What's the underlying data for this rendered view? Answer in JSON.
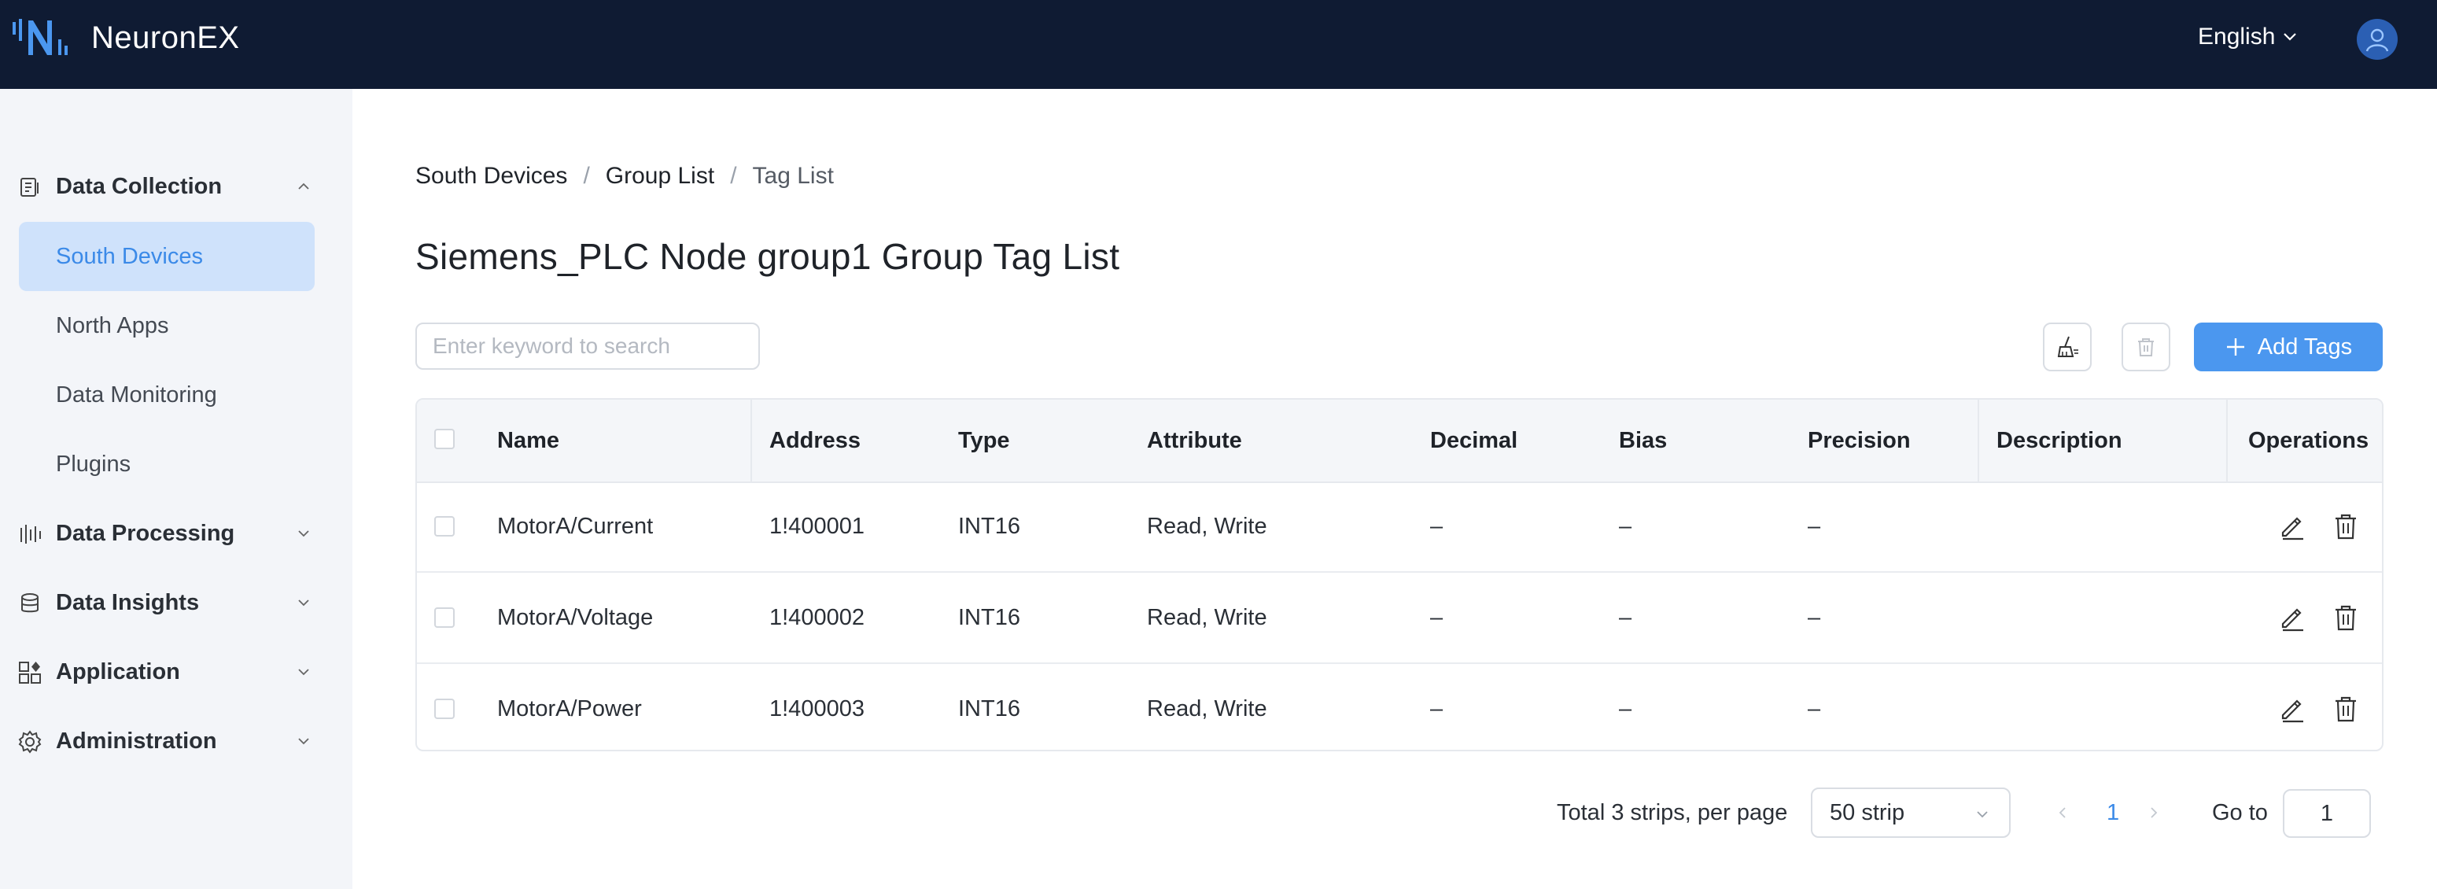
{
  "app": {
    "name": "NeuronEX"
  },
  "header": {
    "language": "English"
  },
  "sidebar": {
    "groups": [
      {
        "label": "Data Collection",
        "icon": "data-collection-icon",
        "expanded": true
      },
      {
        "label": "Data Processing",
        "icon": "data-processing-icon",
        "expanded": false
      },
      {
        "label": "Data Insights",
        "icon": "database-icon",
        "expanded": false
      },
      {
        "label": "Application",
        "icon": "apps-icon",
        "expanded": false
      },
      {
        "label": "Administration",
        "icon": "gear-icon",
        "expanded": false
      }
    ],
    "items": [
      {
        "label": "South Devices",
        "active": true
      },
      {
        "label": "North Apps",
        "active": false
      },
      {
        "label": "Data Monitoring",
        "active": false
      },
      {
        "label": "Plugins",
        "active": false
      }
    ]
  },
  "breadcrumb": [
    "South Devices",
    "Group List",
    "Tag List"
  ],
  "page": {
    "title": "Siemens_PLC Node group1 Group Tag List"
  },
  "toolbar": {
    "search_placeholder": "Enter keyword to search",
    "add_label": "Add Tags"
  },
  "table": {
    "columns": [
      "Name",
      "Address",
      "Type",
      "Attribute",
      "Decimal",
      "Bias",
      "Precision",
      "Description",
      "Operations"
    ],
    "rows": [
      {
        "name": "MotorA/Current",
        "address": "1!400001",
        "type": "INT16",
        "attribute": "Read, Write",
        "decimal": "–",
        "bias": "–",
        "precision": "–",
        "description": ""
      },
      {
        "name": "MotorA/Voltage",
        "address": "1!400002",
        "type": "INT16",
        "attribute": "Read, Write",
        "decimal": "–",
        "bias": "–",
        "precision": "–",
        "description": ""
      },
      {
        "name": "MotorA/Power",
        "address": "1!400003",
        "type": "INT16",
        "attribute": "Read, Write",
        "decimal": "–",
        "bias": "–",
        "precision": "–",
        "description": ""
      }
    ]
  },
  "pagination": {
    "total_text": "Total 3 strips, per page",
    "page_size": "50 strip",
    "current_page": "1",
    "goto_label": "Go to",
    "goto_value": "1"
  },
  "colors": {
    "header_bg": "#0f1b33",
    "accent": "#4b97ef",
    "active_bg": "#cfe2fb",
    "sidebar_bg": "#f3f5f9"
  }
}
